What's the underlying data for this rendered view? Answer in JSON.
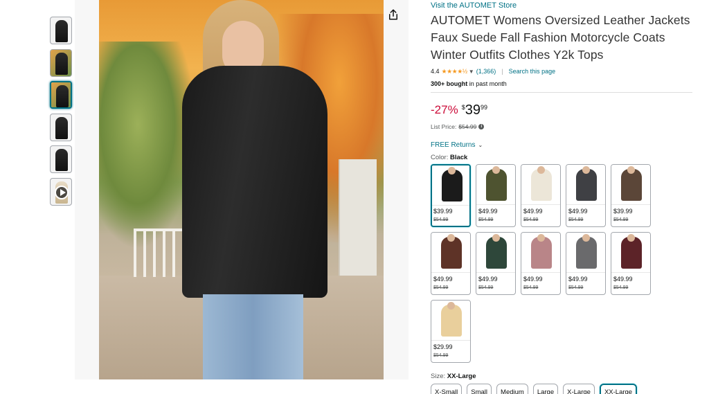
{
  "gallery": {
    "thumbnails": [
      "thumbnail-1",
      "thumbnail-2",
      "thumbnail-3",
      "thumbnail-4",
      "thumbnail-5",
      "thumbnail-video"
    ],
    "active_index": 2
  },
  "share_icon": "share-icon",
  "product": {
    "store_link": "Visit the AUTOMET Store",
    "title": "AUTOMET Womens Oversized Leather Jackets Faux Suede Fall Fashion Motorcycle Coats Winter Outfits Clothes Y2k Tops",
    "rating_value": "4.4",
    "stars": "★★★★½",
    "rating_count": "(1,366)",
    "separator": "|",
    "search_page": "Search this page",
    "bought_bold": "300+ bought",
    "bought_rest": " in past month",
    "discount": "-27%",
    "price_currency": "$",
    "price_whole": "39",
    "price_fraction": "99",
    "list_price_label": "List Price:",
    "list_price": "$54.99",
    "returns": "FREE Returns",
    "color_label": "Color:",
    "color_value": "Black",
    "size_label": "Size:",
    "size_value": "XX-Large"
  },
  "color_options": [
    {
      "name": "black",
      "price": "$39.99",
      "list_price": "$54.99",
      "color": "#1b1b1b",
      "selected": true
    },
    {
      "name": "army-green",
      "price": "$49.99",
      "list_price": "$54.99",
      "color": "#4e5330"
    },
    {
      "name": "cream",
      "price": "$49.99",
      "list_price": "$54.99",
      "color": "#ece6d8"
    },
    {
      "name": "dark-grey",
      "price": "$49.99",
      "list_price": "$54.99",
      "color": "#3f4044"
    },
    {
      "name": "coffee",
      "price": "$39.99",
      "list_price": "$54.99",
      "color": "#5b4638"
    },
    {
      "name": "brown",
      "price": "$49.99",
      "list_price": "$54.99",
      "color": "#5e3327"
    },
    {
      "name": "dark-green",
      "price": "$49.99",
      "list_price": "$54.99",
      "color": "#2e473a"
    },
    {
      "name": "pink",
      "price": "$49.99",
      "list_price": "$54.99",
      "color": "#b98588"
    },
    {
      "name": "grey",
      "price": "$49.99",
      "list_price": "$54.99",
      "color": "#6a6a6c"
    },
    {
      "name": "wine-red",
      "price": "$49.99",
      "list_price": "$54.99",
      "color": "#5c2328"
    },
    {
      "name": "khaki",
      "price": "$29.99",
      "list_price": "$54.99",
      "color": "#e9cf9c"
    }
  ],
  "sizes": [
    {
      "label": "X-Small"
    },
    {
      "label": "Small"
    },
    {
      "label": "Medium"
    },
    {
      "label": "Large"
    },
    {
      "label": "X-Large"
    },
    {
      "label": "XX-Large",
      "selected": true
    }
  ],
  "colors": {
    "link": "#007185",
    "discount": "#CC0C39",
    "star": "#F59A23",
    "selected_border": "#007185"
  }
}
